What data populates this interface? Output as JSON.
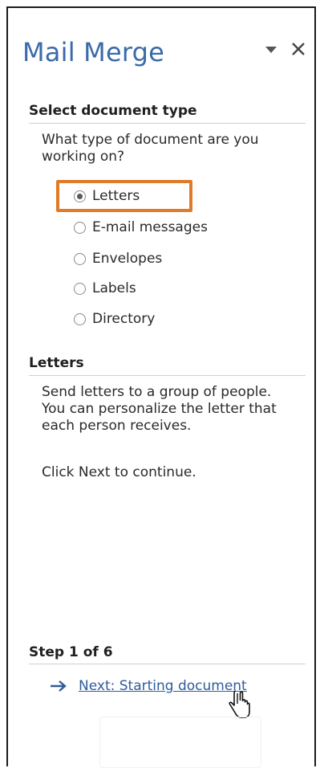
{
  "pane": {
    "title": "Mail Merge"
  },
  "section1": {
    "heading": "Select document type",
    "question": "What type of document are you working on?",
    "options": [
      {
        "label": "Letters",
        "selected": true
      },
      {
        "label": "E-mail messages",
        "selected": false
      },
      {
        "label": "Envelopes",
        "selected": false
      },
      {
        "label": "Labels",
        "selected": false
      },
      {
        "label": "Directory",
        "selected": false
      }
    ]
  },
  "section2": {
    "heading": "Letters",
    "description": "Send letters to a group of people. You can personalize the letter that each person receives.",
    "hint": "Click Next to continue."
  },
  "footer": {
    "step": "Step 1 of 6",
    "next_link": "Next: Starting document"
  },
  "colors": {
    "title_blue": "#3a6aa8",
    "link_blue": "#2f5c9c",
    "highlight_orange": "#e07b2a"
  },
  "icons": {
    "menu": "triangle-down-icon",
    "close": "close-icon",
    "arrow": "arrow-right-icon",
    "cursor": "hand-pointer-icon"
  }
}
